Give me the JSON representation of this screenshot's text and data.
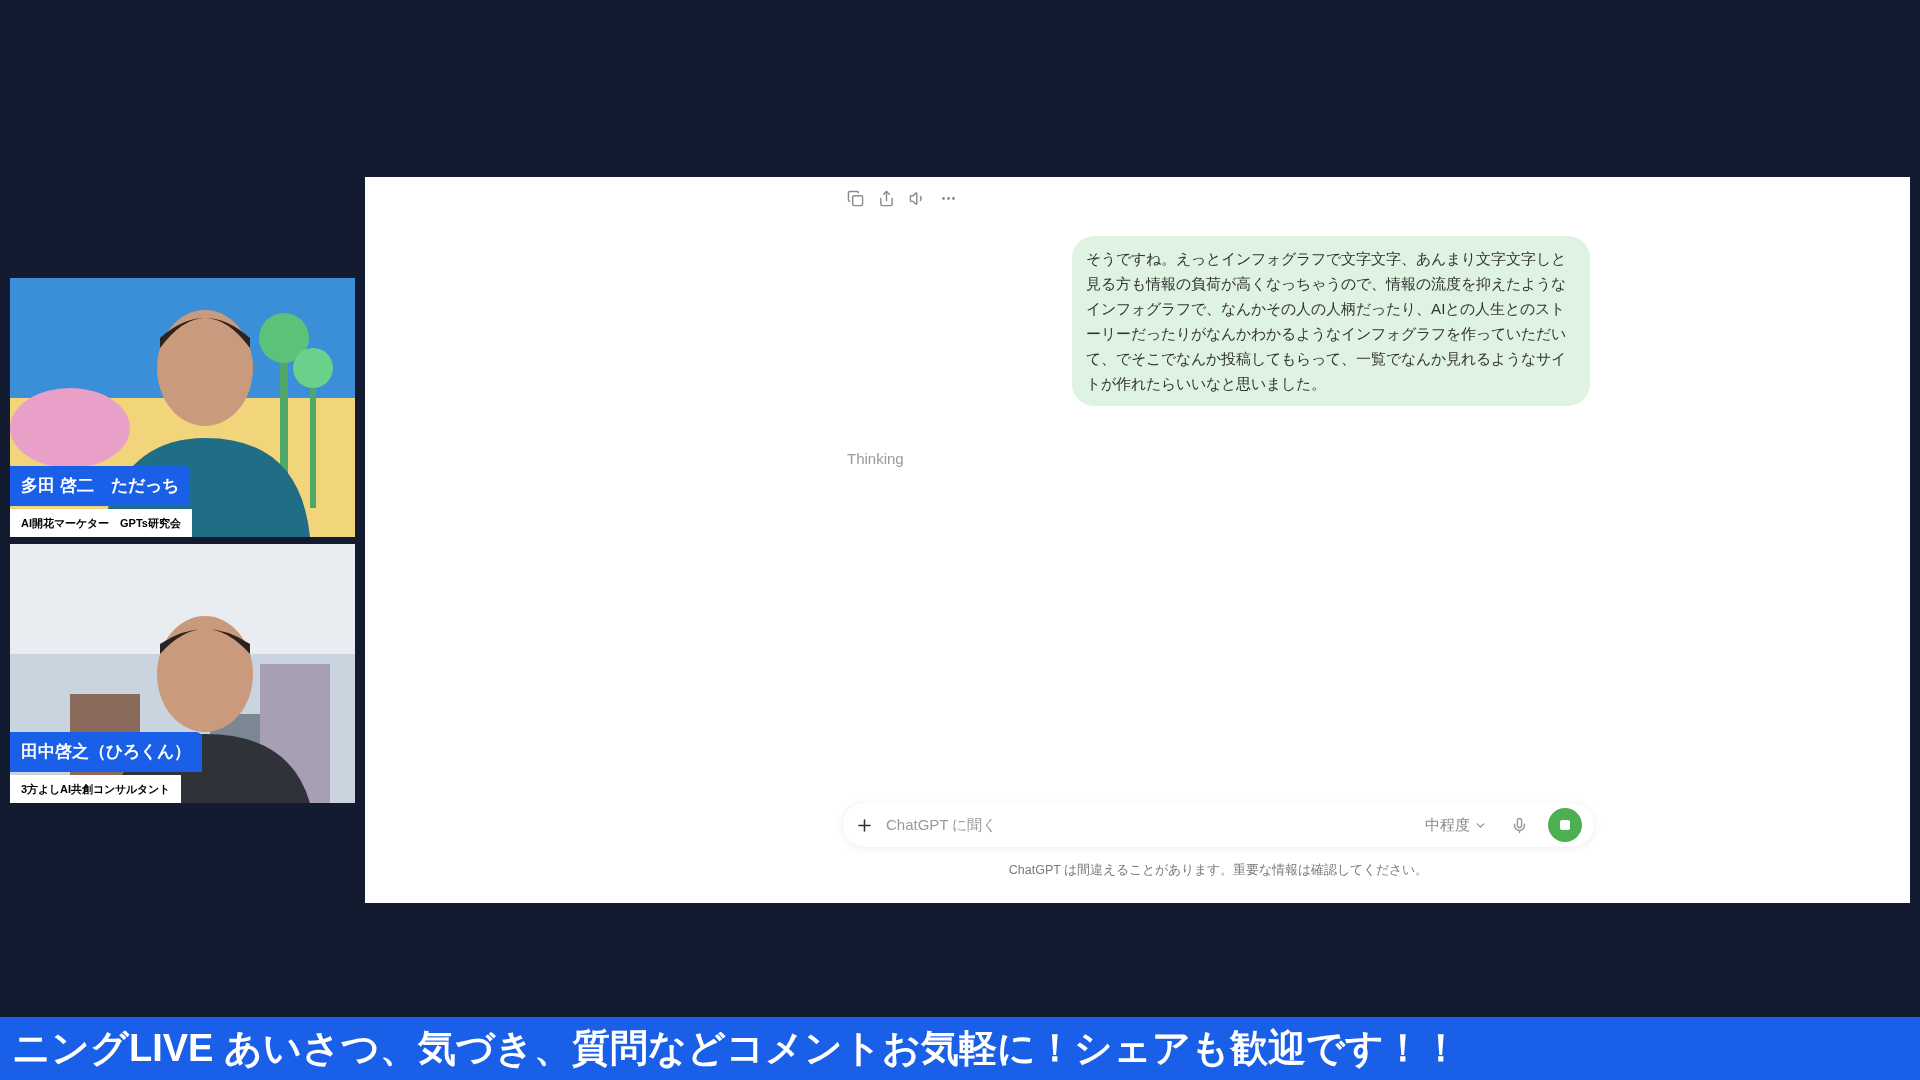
{
  "participants": [
    {
      "name": "多田 啓二　ただっち",
      "role": "AI開花マーケター　GPTs研究会"
    },
    {
      "name": "田中啓之（ひろくん）",
      "role": "3方よしAI共創コンサルタント"
    }
  ],
  "chat": {
    "user_message": "そうですね。えっとインフォグラフで文字文字、あんまり文字文字しと見る方も情報の負荷が高くなっちゃうので、情報の流度を抑えたようなインフォグラフで、なんかその人の人柄だったり、AIとの人生とのストーリーだったりがなんかわかるようなインフォグラフを作っていただいて、でそこでなんか投稿してもらって、一覧でなんか見れるようなサイトが作れたらいいなと思いました。",
    "status": "Thinking",
    "composer": {
      "placeholder": "ChatGPT に聞く",
      "model": "中程度",
      "generating": true
    },
    "disclaimer": "ChatGPT は間違えることがあります。重要な情報は確認してください。"
  },
  "ticker": "ニングLIVE あいさつ、気づき、質問などコメントお気軽に！シェアも歓迎です！！"
}
